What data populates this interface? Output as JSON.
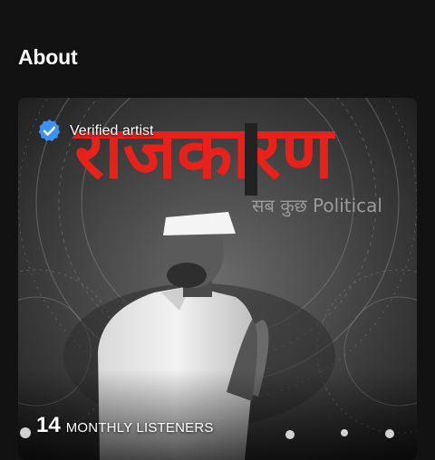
{
  "section": {
    "title": "About"
  },
  "card": {
    "verified_label": "Verified artist",
    "verified_icon": "verified-badge-icon",
    "image_title": "राजकारण",
    "image_subtitle": "सब कुछ Political",
    "listeners_count": "14",
    "listeners_label": "MONTHLY LISTENERS"
  },
  "colors": {
    "background": "#121212",
    "verified_blue": "#3d91f4",
    "title_red": "#e8221b"
  }
}
